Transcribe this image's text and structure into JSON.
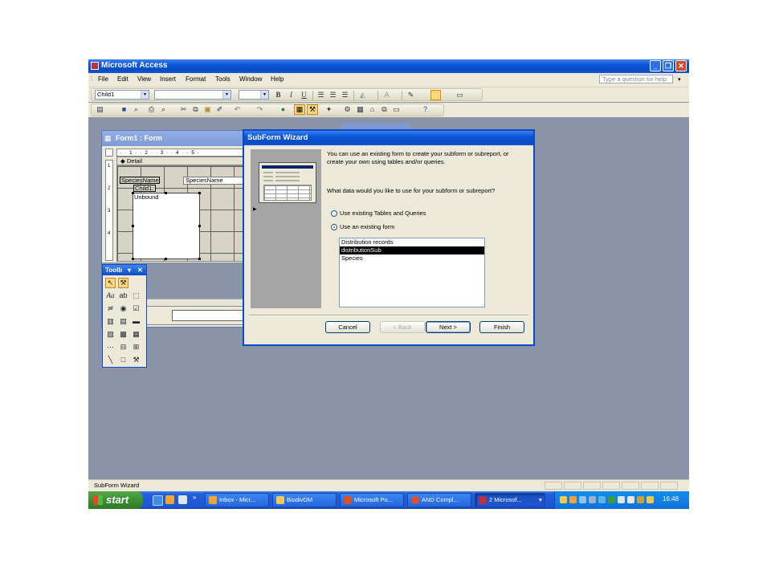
{
  "app": {
    "title": "Microsoft Access"
  },
  "menu": {
    "items": [
      "File",
      "Edit",
      "View",
      "Insert",
      "Format",
      "Tools",
      "Window",
      "Help"
    ],
    "help_placeholder": "Type a question for help"
  },
  "toolbar": {
    "object_combo": "Child1",
    "font_combo": "",
    "size_combo": ""
  },
  "form_window": {
    "title": "Form1 : Form",
    "ruler": "· · 1 · · 2 · · 3 · · 4 · · 5 ·",
    "section": "Detail",
    "label_species": "SpeciesName:",
    "textbox_species": "SpeciesName",
    "label_child": "Child1:",
    "subform_text": "Unbound"
  },
  "toolbox": {
    "title": "Toolb"
  },
  "wizard": {
    "title": "SubForm Wizard",
    "intro": [
      "You can use an existing form to create your subform or subreport, or",
      "create your own using tables and/or queries."
    ],
    "question": "What data would you like to use for your subform or subreport?",
    "options": [
      {
        "label": "Use existing Tables and Queries",
        "selected": false
      },
      {
        "label": "Use an existing form",
        "selected": true
      }
    ],
    "forms": [
      {
        "label": "Distribution records",
        "selected": false
      },
      {
        "label": "distributionSub",
        "selected": true
      },
      {
        "label": "Species",
        "selected": false
      }
    ],
    "buttons": {
      "cancel": "Cancel",
      "back": "< Back",
      "next": "Next >",
      "finish": "Finish"
    }
  },
  "status": {
    "text": "SubForm Wizard"
  },
  "taskbar": {
    "start": "start",
    "tasks": [
      {
        "label": "Inbox - Micr...",
        "color": "#f2a33a"
      },
      {
        "label": "BiodivDM",
        "color": "#f3c85a"
      },
      {
        "label": "Microsoft Po...",
        "color": "#d8512b"
      },
      {
        "label": "AND Compl...",
        "color": "#e54e24"
      },
      {
        "label": "2 Microsof...",
        "color": "#b8304a"
      }
    ],
    "clock": "16:48"
  },
  "colors": {
    "xp_blue": "#0a4bc4",
    "desktop": "#8a93a8",
    "face": "#ece9d8"
  }
}
